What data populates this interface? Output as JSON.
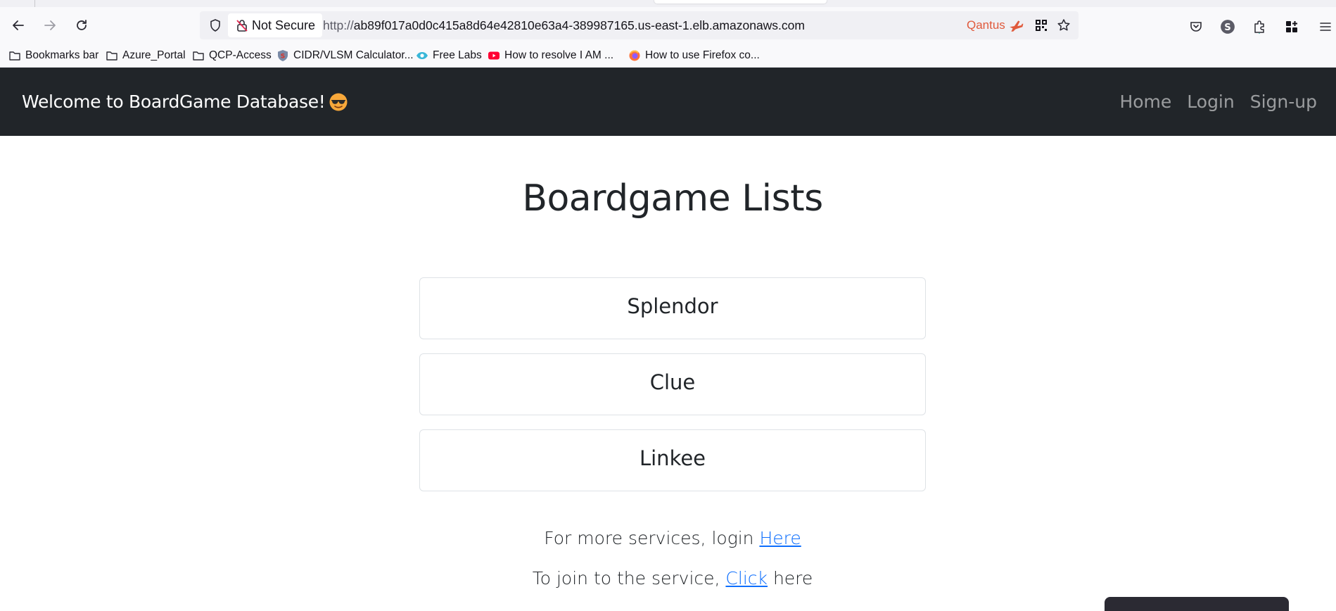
{
  "browser": {
    "security_label": "Not Secure",
    "url_protocol": "http://",
    "url_host": "ab89f017a0d0c415a8d64e42810e63a4-389987165.us-east-1.elb.amazonaws.com",
    "extension_label": "Qantus",
    "accent_color": "#e05a3c"
  },
  "bookmarks": [
    {
      "label": "Bookmarks bar",
      "icon": "folder-icon"
    },
    {
      "label": "Azure_Portal",
      "icon": "folder-icon"
    },
    {
      "label": "QCP-Access",
      "icon": "folder-icon"
    },
    {
      "label": "CIDR/VLSM Calculator...",
      "icon": "shield-logo-icon"
    },
    {
      "label": "Free Labs",
      "icon": "eye-logo-icon"
    },
    {
      "label": "How to resolve I AM ...",
      "icon": "youtube-icon"
    },
    {
      "label": "How to use Firefox co...",
      "icon": "firefox-icon"
    }
  ],
  "site": {
    "brand": "Welcome to BoardGame Database!",
    "brand_emoji": "sunglasses-face-icon",
    "nav": {
      "home": "Home",
      "login": "Login",
      "signup": "Sign-up"
    },
    "navbar_color": "#212529"
  },
  "main": {
    "title": "Boardgame Lists",
    "games": [
      "Splendor",
      "Clue",
      "Linkee"
    ],
    "login_prefix": "For more services, login ",
    "login_link": "Here",
    "join_prefix": "To join to the service, ",
    "join_link": "Click",
    "join_suffix": " here",
    "link_color": "#0d6efd"
  }
}
